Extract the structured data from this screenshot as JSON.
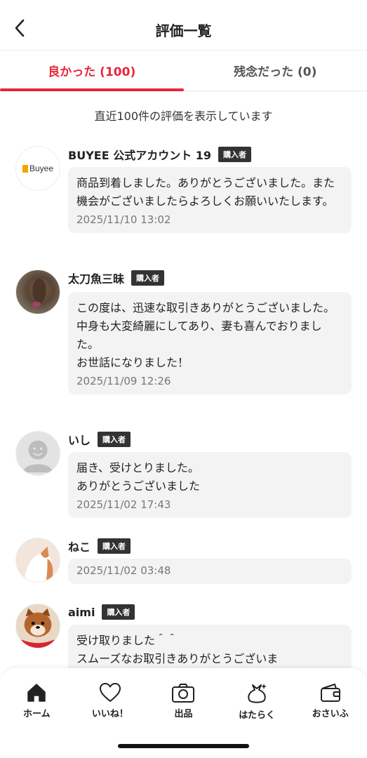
{
  "header": {
    "title": "評価一覧",
    "back_icon": "chevron-left-icon"
  },
  "tabs": [
    {
      "label": "良かった (100)",
      "active": true
    },
    {
      "label": "残念だった (0)",
      "active": false
    }
  ],
  "notice": "直近100件の評価を表示しています",
  "badge_label": "購入者",
  "reviews": [
    {
      "username": "BUYEE 公式アカウント 19",
      "badge": "購入者",
      "comment": "商品到着しました。ありがとうございました。また機会がございましたらよろしくお願いいたします。",
      "date": "2025/11/10 13:02",
      "avatar_text": "Buyee"
    },
    {
      "username": "太刀魚三昧",
      "badge": "購入者",
      "comment": "この度は、迅速な取引きありがとうございました。\n中身も大変綺麗にしてあり、妻も喜んでおりました。\nお世話になりました！",
      "date": "2025/11/09 12:26"
    },
    {
      "username": "いし",
      "badge": "購入者",
      "comment": "届き、受けとりました。\nありがとうございました",
      "date": "2025/11/02 17:43"
    },
    {
      "username": "ねこ",
      "badge": "購入者",
      "comment": "",
      "date": "2025/11/02 03:48"
    },
    {
      "username": "aimi",
      "badge": "購入者",
      "comment": "受け取りました＾＾\nスムーズなお取引きありがとうございま",
      "date": ""
    }
  ],
  "tabbar": [
    {
      "label": "ホーム",
      "icon": "home-icon"
    },
    {
      "label": "いいね！",
      "icon": "heart-icon"
    },
    {
      "label": "出品",
      "icon": "camera-icon"
    },
    {
      "label": "はたらく",
      "icon": "money-bag-icon"
    },
    {
      "label": "おさいふ",
      "icon": "wallet-icon"
    }
  ],
  "colors": {
    "accent": "#e8263a",
    "badge_bg": "#333333",
    "bubble_bg": "#f3f3f3"
  }
}
